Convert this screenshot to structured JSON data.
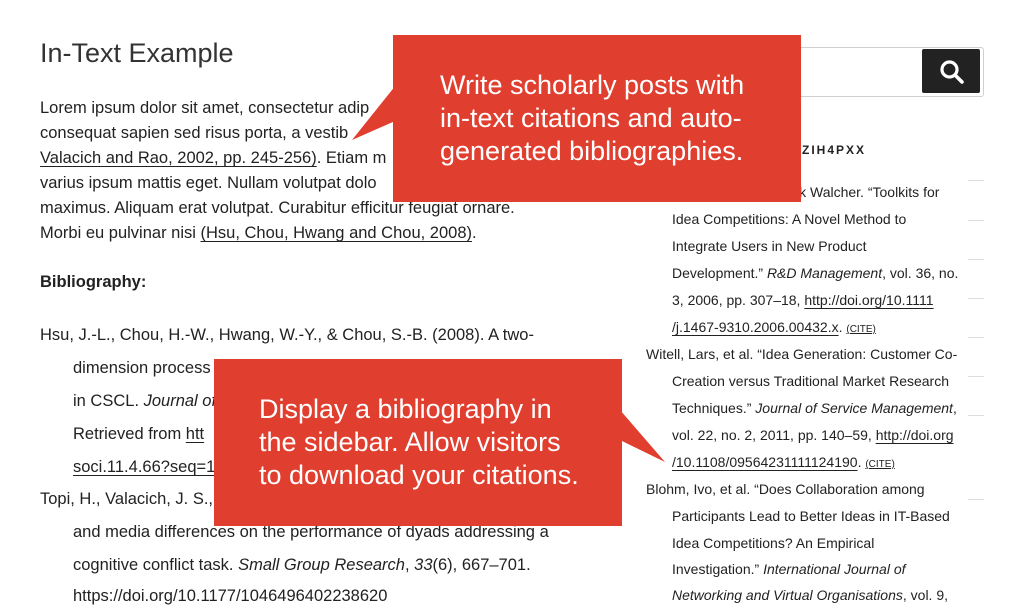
{
  "main": {
    "title": "In-Text Example",
    "para": {
      "l1": "Lorem ipsum dolor sit amet, consectetur adip",
      "l2": "consequat sapien sed risus porta, a vestib",
      "l3_cite": "Valacich and Rao, 2002, pp. 245-256)",
      "l3_rest": ". Etiam m",
      "l4": "varius ipsum mattis eget. Nullam volutpat dolo",
      "l5": "maximus. Aliquam erat volutpat. Curabitur efficitur feugiat ornare.",
      "l6_pre": "Morbi eu pulvinar nisi ",
      "l6_cite": "(Hsu, Chou, Hwang and Chou, 2008)",
      "l6_post": "."
    },
    "bib_heading": "Bibliography:",
    "bib": {
      "e1_l1": "Hsu, J.-L., Chou, H.-W., Hwang, W.-Y., & Chou, S.-B. (2008). A two-",
      "e1_l2": "dimension process",
      "e1_l3a": "in CSCL. ",
      "e1_l3b": "Journal of",
      "e1_l4a": "Retrieved from ",
      "e1_l4b": "htt",
      "e1_l5": "soci.11.4.66?seq=1",
      "e2_l1": "Topi, H., Valacich, J. S., &",
      "e2_l2": "and media differences on the performance of dyads addressing a",
      "e2_l3a": "cognitive conflict task. ",
      "e2_l3b": "Small Group Research",
      "e2_l3c": ", ",
      "e2_l3d": "33",
      "e2_l3e": "(6), 667–701.",
      "e2_l4": "https://doi.org/10.1177/1046496402238620"
    }
  },
  "sidebar": {
    "search_icon": "search-icon",
    "heading": "PZIH4PXX",
    "e1": {
      "l1": "ik Walcher. “Toolkits for",
      "l2": "Idea Competitions: A Novel Method to",
      "l3": "Integrate Users in New Product",
      "l4a": "Development.” ",
      "l4b": "R&D Management",
      "l4c": ", vol. 36, no.",
      "l5a": "3, 2006, pp. 307–18, ",
      "l5b": "http://doi.org/10.1111",
      "l6a": "/j.1467-9310.2006.00432.x",
      "l6b": ". ",
      "cite": "(CITE)"
    },
    "e2": {
      "l1": "Witell, Lars, et al. “Idea Generation: Customer Co-",
      "l2": "Creation versus Traditional Market Research",
      "l3a": "Techniques.” ",
      "l3b": "Journal of Service Management",
      "l3c": ",",
      "l4a": "vol. 22, no. 2, 2011, pp. 140–59, ",
      "l4b": "http://doi.org",
      "l5a": "/10.1108/09564231111124190",
      "l5b": ". ",
      "cite": "(CITE)"
    },
    "e3": {
      "l1": "Blohm, Ivo, et al. “Does Collaboration among",
      "l2": "Participants Lead to Better Ideas in IT-Based",
      "l3": "Idea Competitions? An Empirical",
      "l4a": "Investigation.” ",
      "l4b": "International Journal of",
      "l5a": "Networking and Virtual Organisations",
      "l5b": ", vol. 9,"
    }
  },
  "callouts": {
    "top": [
      "Write scholarly posts with",
      "in-text citations and auto-",
      "generated bibliographies."
    ],
    "bottom": [
      "Display a bibliography in",
      "the sidebar. Allow visitors",
      "to download your citations."
    ],
    "color": "#e03e2f"
  }
}
